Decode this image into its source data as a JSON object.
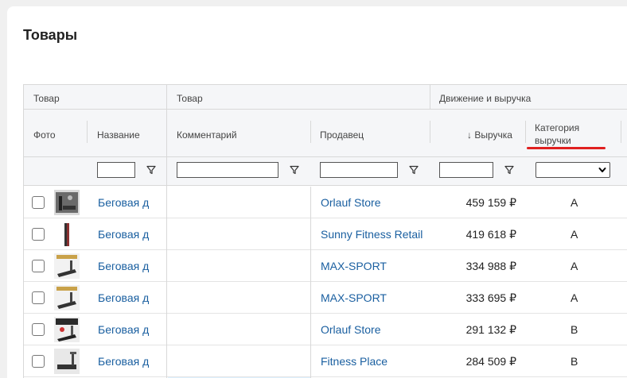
{
  "page": {
    "title": "Товары"
  },
  "groups": {
    "g1": "Товар",
    "g2": "Товар",
    "g3": "Движение и выручка"
  },
  "columns": {
    "photo": "Фото",
    "name": "Название",
    "comment": "Комментарий",
    "seller": "Продавец",
    "revenue_arrow": "↓",
    "revenue": "Выручка",
    "category_l1": "Категория",
    "category_l2": "выручки"
  },
  "icons": {
    "filter": "filter-funnel-icon",
    "select": "chevron-down-icon",
    "sort": "sort-desc-arrow-icon"
  },
  "colors": {
    "link": "#1a5fa0",
    "comment_bg": "#ddf0fd",
    "annotation": "#e02020"
  },
  "rows": [
    {
      "name": "Беговая д",
      "seller": "Orlauf Store",
      "revenue": "459 159 ₽",
      "category": "A"
    },
    {
      "name": "Беговая д",
      "seller": "Sunny Fitness Retail",
      "revenue": "419 618 ₽",
      "category": "A"
    },
    {
      "name": "Беговая д",
      "seller": "MAX-SPORT",
      "revenue": "334 988 ₽",
      "category": "A"
    },
    {
      "name": "Беговая д",
      "seller": "MAX-SPORT",
      "revenue": "333 695 ₽",
      "category": "A"
    },
    {
      "name": "Беговая д",
      "seller": "Orlauf Store",
      "revenue": "291 132 ₽",
      "category": "B"
    },
    {
      "name": "Беговая д",
      "seller": "Fitness Place",
      "revenue": "284 509 ₽",
      "category": "B"
    }
  ]
}
